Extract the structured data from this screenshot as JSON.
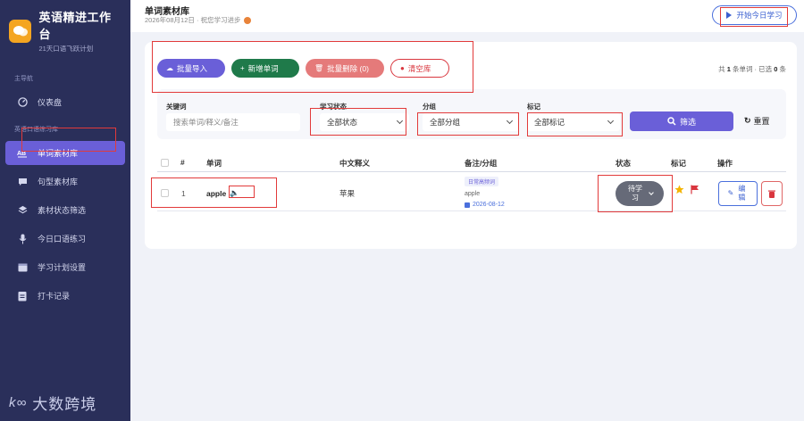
{
  "brand": {
    "title": "英语精进工作台",
    "subtitle": "21天口语飞跃计划"
  },
  "sidebar": {
    "section_main": "主导航",
    "section_practice": "英语口语练习库",
    "items": [
      {
        "label": "仪表盘",
        "icon": "dashboard-icon"
      },
      {
        "label": "单词素材库",
        "icon": "ab-icon",
        "active": true
      },
      {
        "label": "句型素材库",
        "icon": "chat-icon"
      },
      {
        "label": "素材状态筛选",
        "icon": "layers-icon"
      },
      {
        "label": "今日口语练习",
        "icon": "microphone-icon"
      },
      {
        "label": "学习计划设置",
        "icon": "calendar-icon"
      },
      {
        "label": "打卡记录",
        "icon": "checklist-icon"
      }
    ]
  },
  "watermark": {
    "mark": "k∞",
    "text": "大数跨境"
  },
  "header": {
    "title": "单词素材库",
    "subtitle": "2026年08月12日 · 祝您学习进步",
    "start_button": "开始今日学习"
  },
  "toolbar": {
    "import_label": "批量导入",
    "add_label": "新增单词",
    "batch_delete_label": "批量删除 (0)",
    "clear_label": "清空库"
  },
  "count_info": {
    "prefix": "共 ",
    "total": "1",
    "mid": " 条单词 · 已选 ",
    "selected": "0",
    "suffix": " 条"
  },
  "filters": {
    "keyword_label": "关键词",
    "keyword_placeholder": "搜索单词/释义/备注",
    "status_label": "学习状态",
    "status_value": "全部状态",
    "group_label": "分组",
    "group_value": "全部分组",
    "mark_label": "标记",
    "mark_value": "全部标记",
    "filter_button": "筛选",
    "reset_button": "重置"
  },
  "table": {
    "headers": {
      "index": "#",
      "word": "单词",
      "meaning": "中文释义",
      "note": "备注/分组",
      "status": "状态",
      "mark": "标记",
      "actions": "操作"
    },
    "rows": [
      {
        "index": "1",
        "word": "apple",
        "meaning": "苹果",
        "group_tag": "日常高频词",
        "note": "apple",
        "date": "2026-08-12",
        "status": "待学习",
        "edit_label": "编辑"
      }
    ]
  },
  "colors": {
    "sidebar_bg": "#2a2f5a",
    "accent": "#6a5fd8",
    "add_green": "#1f7a4a",
    "danger": "#d9363e"
  }
}
